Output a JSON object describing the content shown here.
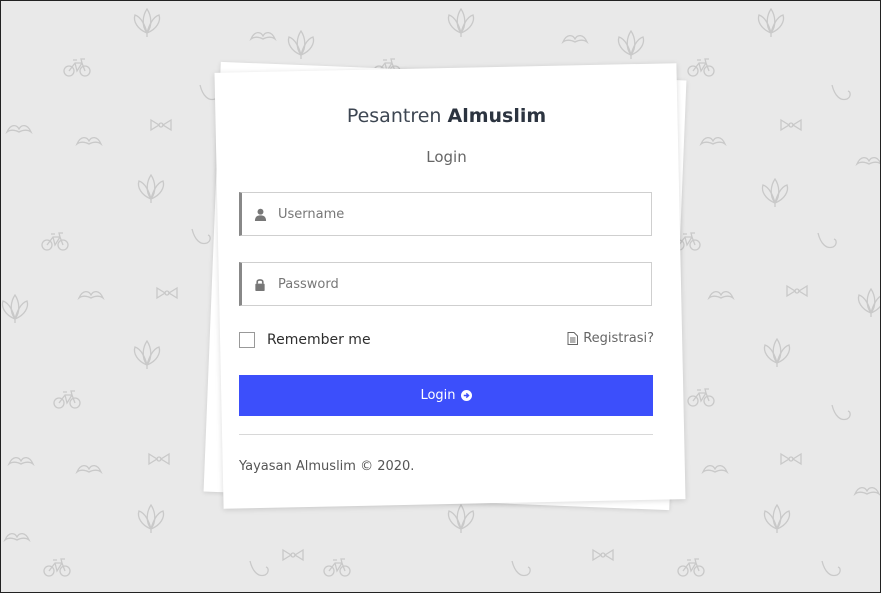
{
  "brand": {
    "prefix": "Pesantren",
    "name": "Almuslim"
  },
  "page": {
    "subtitle": "Login"
  },
  "form": {
    "username_placeholder": "Username",
    "password_placeholder": "Password",
    "remember_label": "Remember me",
    "register_label": "Registrasi?",
    "login_label": "Login"
  },
  "footer": {
    "text": "Yayasan Almuslim © 2020."
  },
  "colors": {
    "primary": "#3c4ffb",
    "background": "#e9e9e9"
  },
  "icons": {
    "username": "user-icon",
    "password": "lock-icon",
    "register": "document-icon",
    "login": "circle-arrow-right-icon"
  }
}
